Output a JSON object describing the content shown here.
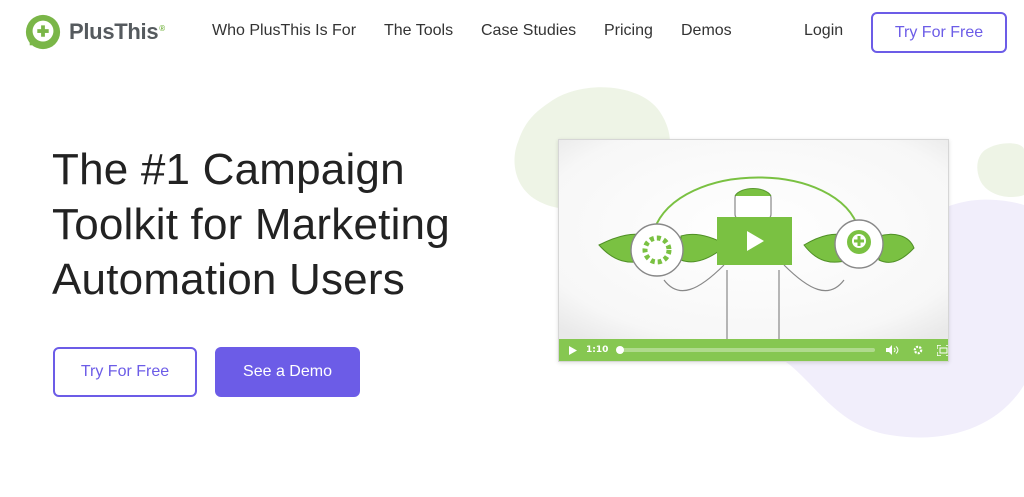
{
  "brand": {
    "name": "PlusThis",
    "registered": "®",
    "accent": "#7ab648"
  },
  "nav": {
    "links": [
      "Who PlusThis Is For",
      "The Tools",
      "Case Studies",
      "Pricing",
      "Demos"
    ],
    "login": "Login",
    "cta": "Try For Free"
  },
  "hero": {
    "title_lines": [
      "The #1 Campaign",
      "Toolkit for Marketing",
      "Automation Users"
    ],
    "primary_cta": "Try For Free",
    "secondary_cta": "See a Demo"
  },
  "video": {
    "time": "1:10",
    "progress": 0,
    "controls": [
      "play-icon",
      "volume-icon",
      "settings-icon",
      "fullscreen-icon"
    ],
    "accent": "#7ac142"
  },
  "colors": {
    "purple": "#6c5ce7",
    "green": "#7ab648"
  }
}
